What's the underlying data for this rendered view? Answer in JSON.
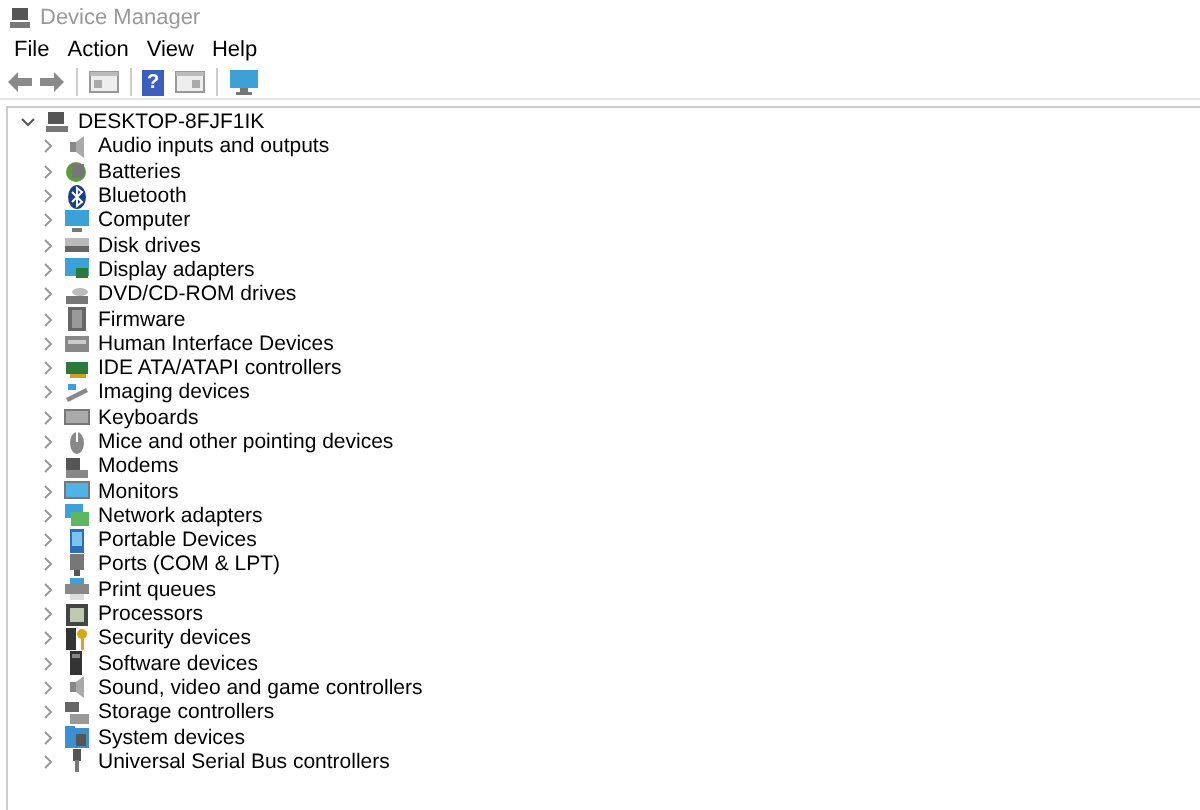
{
  "window": {
    "title": "Device Manager"
  },
  "menu": [
    "File",
    "Action",
    "View",
    "Help"
  ],
  "toolbar": {
    "help_glyph": "?"
  },
  "tree": {
    "label": "DESKTOP-8FJF1IK",
    "expanded": true,
    "children": [
      {
        "label": "Audio inputs and outputs",
        "expanded": false
      },
      {
        "label": "Batteries",
        "expanded": false
      },
      {
        "label": "Bluetooth",
        "expanded": false
      },
      {
        "label": "Computer",
        "expanded": false
      },
      {
        "label": "Disk drives",
        "expanded": false
      },
      {
        "label": "Display adapters",
        "expanded": false
      },
      {
        "label": "DVD/CD-ROM drives",
        "expanded": false
      },
      {
        "label": "Firmware",
        "expanded": false
      },
      {
        "label": "Human Interface Devices",
        "expanded": false
      },
      {
        "label": "IDE ATA/ATAPI controllers",
        "expanded": false
      },
      {
        "label": "Imaging devices",
        "expanded": false
      },
      {
        "label": "Keyboards",
        "expanded": false
      },
      {
        "label": "Mice and other pointing devices",
        "expanded": false
      },
      {
        "label": "Modems",
        "expanded": false
      },
      {
        "label": "Monitors",
        "expanded": false
      },
      {
        "label": "Network adapters",
        "expanded": false
      },
      {
        "label": "Portable Devices",
        "expanded": false
      },
      {
        "label": "Ports (COM & LPT)",
        "expanded": false
      },
      {
        "label": "Print queues",
        "expanded": false
      },
      {
        "label": "Processors",
        "expanded": false
      },
      {
        "label": "Security devices",
        "expanded": false
      },
      {
        "label": "Software devices",
        "expanded": false
      },
      {
        "label": "Sound, video and game controllers",
        "expanded": false
      },
      {
        "label": "Storage controllers",
        "expanded": false
      },
      {
        "label": "System devices",
        "expanded": false
      },
      {
        "label": "Universal Serial Bus controllers",
        "expanded": false
      }
    ]
  }
}
